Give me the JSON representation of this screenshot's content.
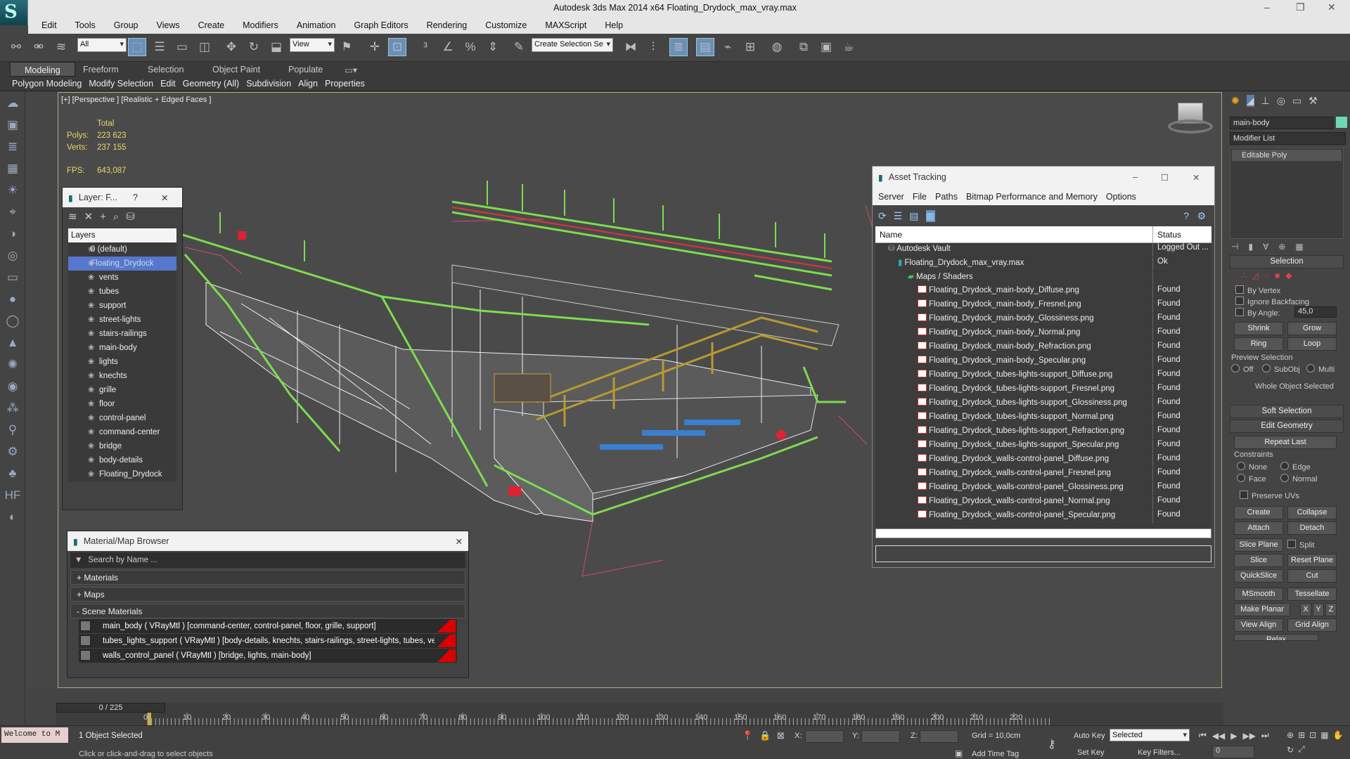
{
  "window": {
    "title": "Autodesk 3ds Max  2014 x64     Floating_Drydock_max_vray.max",
    "controls": [
      "–",
      "❐",
      "✕"
    ]
  },
  "menu": [
    "Edit",
    "Tools",
    "Group",
    "Views",
    "Create",
    "Modifiers",
    "Animation",
    "Graph Editors",
    "Rendering",
    "Customize",
    "MAXScript",
    "Help"
  ],
  "toolbar": {
    "filter": "All",
    "refcoord": "View",
    "selset": "Create Selection Se"
  },
  "ribbon": {
    "tabs": [
      "Modeling",
      "Freeform",
      "Selection",
      "Object Paint",
      "Populate"
    ],
    "active": "Modeling",
    "subs": [
      "Polygon Modeling",
      "Modify Selection",
      "Edit",
      "Geometry (All)",
      "Subdivision",
      "Align",
      "Properties"
    ]
  },
  "viewport": {
    "label": "[+] [Perspective ] [Realistic + Edged Faces ]",
    "stats_header": "Total",
    "polys_label": "Polys:",
    "polys": "223 623",
    "verts_label": "Verts:",
    "verts": "237 155",
    "fps_label": "FPS:",
    "fps": "643,087"
  },
  "layer": {
    "title": "Layer: F...",
    "help": "?",
    "close": "✕",
    "header": "Layers",
    "items": [
      "0 (default)",
      "Floating_Drydock",
      "vents",
      "tubes",
      "support",
      "street-lights",
      "stairs-railings",
      "main-body",
      "lights",
      "knechts",
      "grille",
      "floor",
      "control-panel",
      "command-center",
      "bridge",
      "body-details",
      "Floating_Drydock"
    ],
    "selected": 1
  },
  "materials": {
    "title": "Material/Map Browser",
    "close": "✕",
    "search": "Search by Name ...",
    "groups": [
      "+ Materials",
      "+ Maps",
      "- Scene Materials"
    ],
    "scene": [
      "main_body  ( VRayMtl )  [command-center, control-panel, floor, grille, support]",
      "tubes_lights_support  ( VRayMtl )  [body-details, knechts, stairs-railings, street-lights, tubes, vents]",
      "walls_control_panel  ( VRayMtl )  [bridge, lights, main-body]"
    ]
  },
  "asset": {
    "title": "Asset Tracking",
    "menu": [
      "Server",
      "File",
      "Paths",
      "Bitmap Performance and Memory",
      "Options"
    ],
    "col_name": "Name",
    "col_status": "Status",
    "rows": [
      {
        "name": "Autodesk Vault",
        "status": "Logged Out ...",
        "indent": 1,
        "icon": "vault"
      },
      {
        "name": "Floating_Drydock_max_vray.max",
        "status": "Ok",
        "indent": 2,
        "icon": "file"
      },
      {
        "name": "Maps / Shaders",
        "status": "",
        "indent": 3,
        "icon": "folder"
      },
      {
        "name": "Floating_Drydock_main-body_Diffuse.png",
        "status": "Found",
        "indent": 4,
        "icon": "png"
      },
      {
        "name": "Floating_Drydock_main-body_Fresnel.png",
        "status": "Found",
        "indent": 4,
        "icon": "png"
      },
      {
        "name": "Floating_Drydock_main-body_Glossiness.png",
        "status": "Found",
        "indent": 4,
        "icon": "png"
      },
      {
        "name": "Floating_Drydock_main-body_Normal.png",
        "status": "Found",
        "indent": 4,
        "icon": "png"
      },
      {
        "name": "Floating_Drydock_main-body_Refraction.png",
        "status": "Found",
        "indent": 4,
        "icon": "png"
      },
      {
        "name": "Floating_Drydock_main-body_Specular.png",
        "status": "Found",
        "indent": 4,
        "icon": "png"
      },
      {
        "name": "Floating_Drydock_tubes-lights-support_Diffuse.png",
        "status": "Found",
        "indent": 4,
        "icon": "png"
      },
      {
        "name": "Floating_Drydock_tubes-lights-support_Fresnel.png",
        "status": "Found",
        "indent": 4,
        "icon": "png"
      },
      {
        "name": "Floating_Drydock_tubes-lights-support_Glossiness.png",
        "status": "Found",
        "indent": 4,
        "icon": "png"
      },
      {
        "name": "Floating_Drydock_tubes-lights-support_Normal.png",
        "status": "Found",
        "indent": 4,
        "icon": "png"
      },
      {
        "name": "Floating_Drydock_tubes-lights-support_Refraction.png",
        "status": "Found",
        "indent": 4,
        "icon": "png"
      },
      {
        "name": "Floating_Drydock_tubes-lights-support_Specular.png",
        "status": "Found",
        "indent": 4,
        "icon": "png"
      },
      {
        "name": "Floating_Drydock_walls-control-panel_Diffuse.png",
        "status": "Found",
        "indent": 4,
        "icon": "png"
      },
      {
        "name": "Floating_Drydock_walls-control-panel_Fresnel.png",
        "status": "Found",
        "indent": 4,
        "icon": "png"
      },
      {
        "name": "Floating_Drydock_walls-control-panel_Glossiness.png",
        "status": "Found",
        "indent": 4,
        "icon": "png"
      },
      {
        "name": "Floating_Drydock_walls-control-panel_Normal.png",
        "status": "Found",
        "indent": 4,
        "icon": "png"
      },
      {
        "name": "Floating_Drydock_walls-control-panel_Specular.png",
        "status": "Found",
        "indent": 4,
        "icon": "png"
      }
    ]
  },
  "cmd": {
    "object": "main-body",
    "modlist": "Modifier List",
    "stack": "Editable Poly",
    "selection": "Selection",
    "by_vertex": "By Vertex",
    "ignore_back": "Ignore Backfacing",
    "by_angle": "By Angle:",
    "angle": "45,0",
    "shrink": "Shrink",
    "grow": "Grow",
    "ring": "Ring",
    "loop": "Loop",
    "preview": "Preview Selection",
    "off": "Off",
    "subobj": "SubObj",
    "multi": "Multi",
    "whole": "Whole Object Selected",
    "soft": "Soft Selection",
    "editgeo": "Edit Geometry",
    "repeat": "Repeat Last",
    "constraints": "Constraints",
    "none": "None",
    "edge": "Edge",
    "face": "Face",
    "normal": "Normal",
    "preserve": "Preserve UVs",
    "create": "Create",
    "collapse": "Collapse",
    "attach": "Attach",
    "detach": "Detach",
    "slice_plane": "Slice Plane",
    "split": "Split",
    "slice": "Slice",
    "reset_plane": "Reset Plane",
    "quickslice": "QuickSlice",
    "cut": "Cut",
    "msmooth": "MSmooth",
    "tessellate": "Tessellate",
    "make_planar": "Make Planar",
    "x": "X",
    "y": "Y",
    "z": "Z",
    "view_align": "View Align",
    "grid_align": "Grid Align",
    "relax": "Relax"
  },
  "timeline": {
    "frame": "0 / 225",
    "ticks": [
      "0",
      "10",
      "20",
      "30",
      "40",
      "50",
      "60",
      "70",
      "80",
      "90",
      "100",
      "110",
      "120",
      "130",
      "140",
      "150",
      "160",
      "170",
      "180",
      "190",
      "200",
      "210",
      "220"
    ]
  },
  "status": {
    "welcome": "Welcome to M",
    "selected": "1 Object Selected",
    "hint": "Click or click-and-drag to select objects",
    "x": "X:",
    "y": "Y:",
    "z": "Z:",
    "grid": "Grid = 10,0cm",
    "autokey": "Auto Key",
    "setkey": "Set Key",
    "selmode": "Selected",
    "keyfilters": "Key Filters...",
    "addtime": "Add Time Tag",
    "frame": "0"
  }
}
